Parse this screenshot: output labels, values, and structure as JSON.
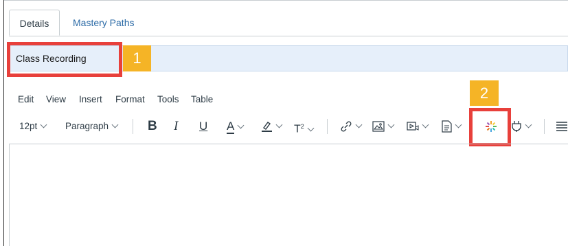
{
  "tabs": [
    {
      "label": "Details",
      "active": true
    },
    {
      "label": "Mastery Paths",
      "active": false
    }
  ],
  "title_field": {
    "value": "Class Recording"
  },
  "callouts": [
    {
      "number": "1",
      "color": "#f5b426",
      "highlight_color": "#e8403b"
    },
    {
      "number": "2",
      "color": "#f5b426",
      "highlight_color": "#e8403b"
    }
  ],
  "menubar": [
    "Edit",
    "View",
    "Insert",
    "Format",
    "Tools",
    "Table"
  ],
  "toolbar": {
    "font_size": "12pt",
    "block_format": "Paragraph",
    "bold": "B",
    "italic": "I",
    "underline": "U",
    "text_color": "A",
    "superscript_base": "T",
    "superscript_mark": "2",
    "icons": [
      "link-icon",
      "image-icon",
      "media-icon",
      "document-icon",
      "ai-sparkle-icon",
      "plugin-icon",
      "align-icon"
    ]
  },
  "colors": {
    "link_blue": "#2b6aa6",
    "title_bg": "#e6effa",
    "accent_red": "#e8403b",
    "badge_yellow": "#f5b426"
  }
}
